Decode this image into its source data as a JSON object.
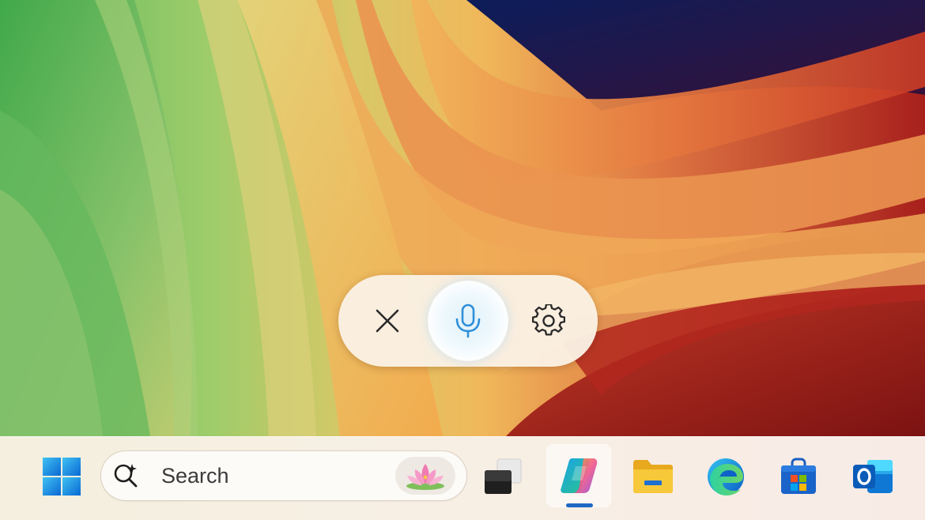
{
  "voice_typing": {
    "close_icon": "close-icon",
    "mic_icon": "microphone-icon",
    "settings_icon": "gear-icon",
    "accent": "#2f8fd8"
  },
  "taskbar": {
    "start_icon": "windows-logo-icon",
    "search": {
      "placeholder": "Search",
      "icon": "search-sparkle-icon",
      "highlight_icon": "lotus-icon"
    },
    "apps": [
      {
        "name": "task-view",
        "icon": "task-view-icon"
      },
      {
        "name": "copilot",
        "icon": "copilot-icon",
        "active": true
      },
      {
        "name": "file-explorer",
        "icon": "folder-icon"
      },
      {
        "name": "edge",
        "icon": "edge-icon"
      },
      {
        "name": "microsoft-store",
        "icon": "store-bag-icon"
      },
      {
        "name": "outlook",
        "icon": "outlook-icon"
      }
    ],
    "accent": "#1f68c4"
  }
}
